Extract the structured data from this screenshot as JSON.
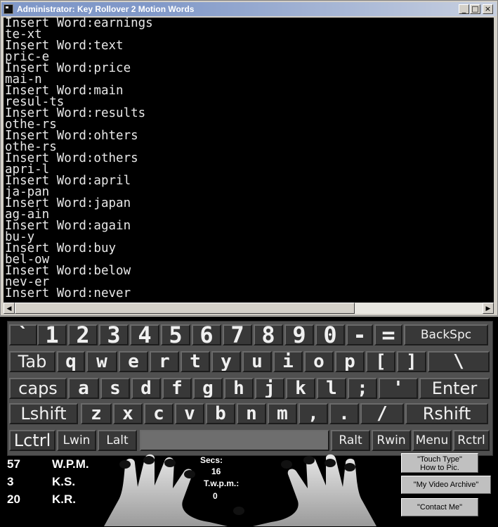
{
  "window": {
    "title": "Administrator:  Key Rollover 2 Motion Words",
    "minimize_glyph": "_",
    "maximize_glyph": "□",
    "close_glyph": "×"
  },
  "console": {
    "lines": [
      "Insert Word:earnings",
      "te-xt",
      "Insert Word:text",
      "pric-e",
      "Insert Word:price",
      "mai-n",
      "Insert Word:main",
      "resul-ts",
      "Insert Word:results",
      "othe-rs",
      "Insert Word:ohters",
      "othe-rs",
      "Insert Word:others",
      "apri-l",
      "Insert Word:april",
      "ja-pan",
      "Insert Word:japan",
      "ag-ain",
      "Insert Word:again",
      "bu-y",
      "Insert Word:buy",
      "bel-ow",
      "Insert Word:below",
      "nev-er",
      "Insert Word:never"
    ],
    "scroll_left_glyph": "◀",
    "scroll_right_glyph": "▶"
  },
  "keyboard": {
    "rows": [
      [
        "`",
        "1",
        "2",
        "3",
        "4",
        "5",
        "6",
        "7",
        "8",
        "9",
        "0",
        "-",
        "=",
        "BackSpc"
      ],
      [
        "Tab",
        "q",
        "w",
        "e",
        "r",
        "t",
        "y",
        "u",
        "i",
        "o",
        "p",
        "[",
        "]",
        "\\"
      ],
      [
        "caps",
        "a",
        "s",
        "d",
        "f",
        "g",
        "h",
        "j",
        "k",
        "l",
        ";",
        "'",
        "Enter"
      ],
      [
        "Lshift",
        "z",
        "x",
        "c",
        "v",
        "b",
        "n",
        "m",
        ",",
        ".",
        "/",
        "Rshift"
      ],
      [
        "Lctrl",
        "Lwin",
        "Lalt",
        "",
        "Ralt",
        "Rwin",
        "Menu",
        "Rctrl"
      ]
    ]
  },
  "stats": {
    "wpm_value": "57",
    "wpm_label": "W.P.M.",
    "ks_value": "3",
    "ks_label": "K.S.",
    "kr_value": "20",
    "kr_label": "K.R.",
    "secs_label": "Secs:",
    "secs_value": "16",
    "twpm_label": "T.w.p.m.:",
    "twpm_value": "0"
  },
  "buttons": {
    "touch_type_line1": "\"Touch Type\"",
    "touch_type_line2": "How to Pic.",
    "video_archive": "\"My Video Archive\"",
    "contact_me": "\"Contact Me\""
  },
  "colors": {
    "console_bg": "#000000",
    "key_face": "#383838",
    "keyboard_panel": "#505050",
    "titlebar": "#8098c8"
  }
}
